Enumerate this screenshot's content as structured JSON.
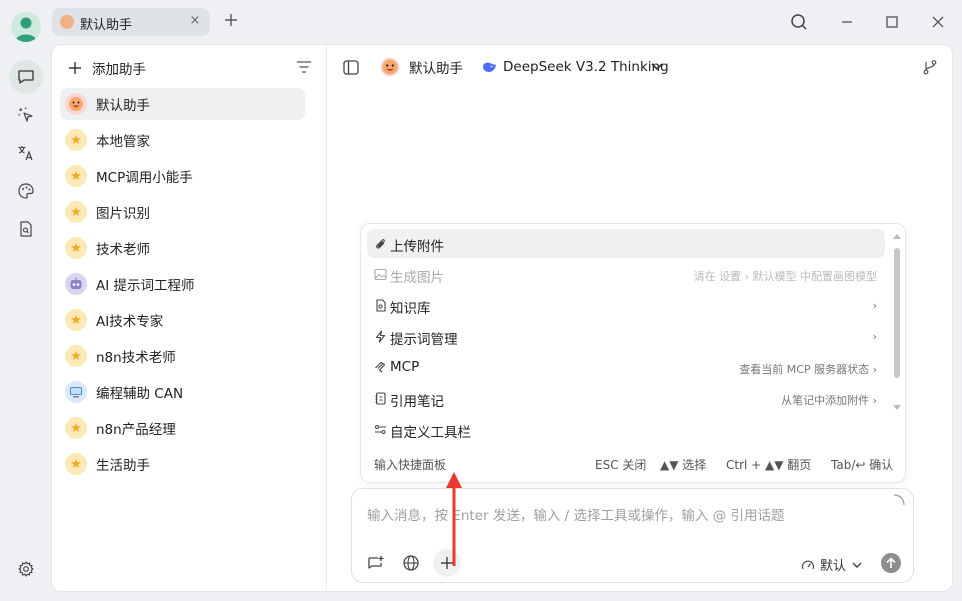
{
  "titlebar": {
    "tab_label": "默认助手",
    "tab_close": "×",
    "new_tab": "+"
  },
  "sidebar": {
    "add_label": "添加助手",
    "assistants": [
      {
        "name": "默认助手",
        "icon": "face-emoji-icon",
        "active": true
      },
      {
        "name": "本地管家",
        "icon": "star-icon"
      },
      {
        "name": "MCP调用小能手",
        "icon": "star-icon"
      },
      {
        "name": "图片识别",
        "icon": "star-icon"
      },
      {
        "name": "技术老师",
        "icon": "star-icon"
      },
      {
        "name": "AI 提示词工程师",
        "icon": "robot-icon"
      },
      {
        "name": "AI技术专家",
        "icon": "star-icon"
      },
      {
        "name": "n8n技术老师",
        "icon": "star-icon"
      },
      {
        "name": "编程辅助 CAN",
        "icon": "computer-icon"
      },
      {
        "name": "n8n产品经理",
        "icon": "star-icon"
      },
      {
        "name": "生活助手",
        "icon": "star-icon"
      }
    ]
  },
  "chat_header": {
    "assistant_name": "默认助手",
    "model_name": "DeepSeek V3.2 Thinking"
  },
  "quick_panel": {
    "items": [
      {
        "label": "上传附件",
        "hint": "",
        "icon": "paperclip-icon"
      },
      {
        "label": "生成图片",
        "hint": "请在 设置 › 默认模型 中配置画图模型",
        "icon": "image-icon"
      },
      {
        "label": "知识库",
        "hint": "›",
        "icon": "knowledge-icon"
      },
      {
        "label": "提示词管理",
        "hint": "›",
        "icon": "lightning-icon"
      },
      {
        "label": "MCP",
        "hint": "查看当前 MCP 服务器状态 ›",
        "icon": "mcp-icon"
      },
      {
        "label": "引用笔记",
        "hint": "从笔记中添加附件 ›",
        "icon": "note-icon"
      },
      {
        "label": "自定义工具栏",
        "hint": "",
        "icon": "toolbar-icon"
      }
    ],
    "footer": {
      "title": "输入快捷面板",
      "esc": "ESC 关闭",
      "select": "▲▼ 选择",
      "page": "Ctrl + ▲▼ 翻页",
      "confirm": "Tab/↩ 确认"
    }
  },
  "input": {
    "placeholder": "输入消息，按 Enter 发送，输入 / 选择工具或操作，输入 @ 引用话题",
    "model_select": "默认"
  },
  "colors": {
    "accent_green": "#2fa179",
    "annotation_arrow": "#e8382f",
    "star": "#f5a623"
  }
}
